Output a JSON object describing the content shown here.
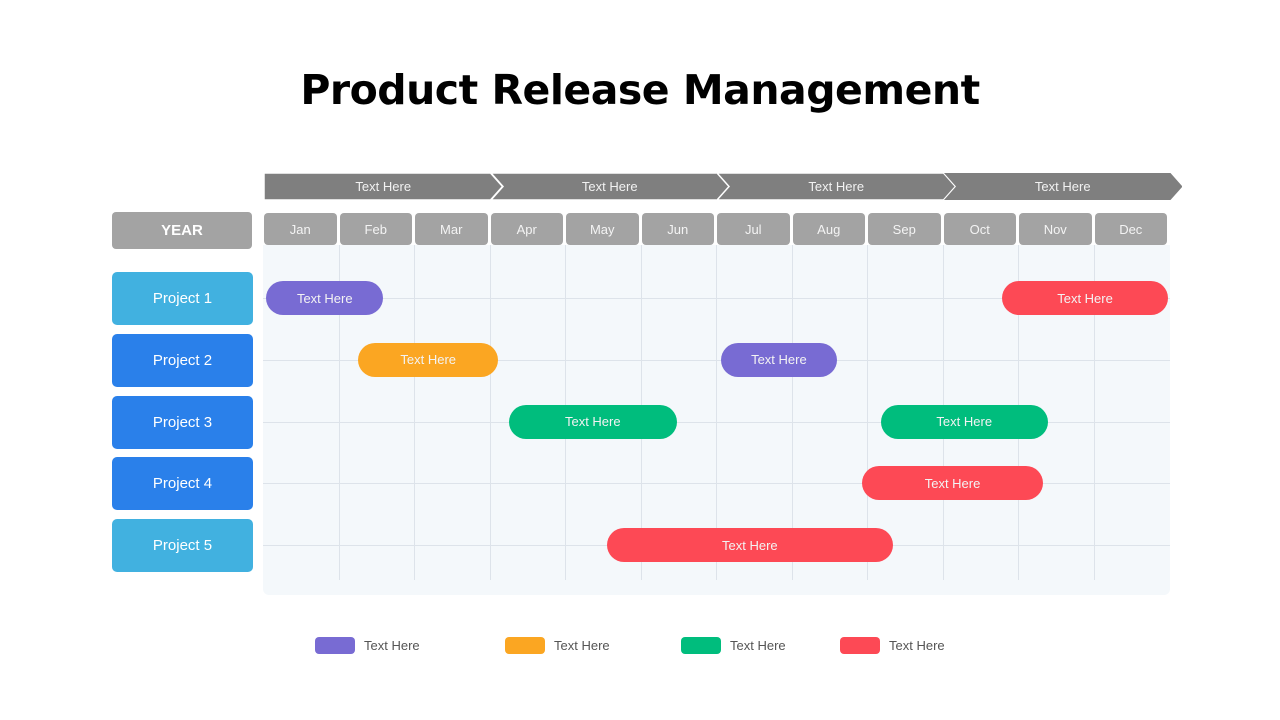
{
  "title": "Product Release Management",
  "chart_data": {
    "type": "gantt",
    "title": "Product Release Management",
    "year_label": "YEAR",
    "phases": [
      "Text Here",
      "Text Here",
      "Text Here",
      "Text Here"
    ],
    "phase_spans_months": [
      [
        0,
        3
      ],
      [
        3,
        6
      ],
      [
        6,
        9
      ],
      [
        9,
        12
      ]
    ],
    "months": [
      "Jan",
      "Feb",
      "Mar",
      "Apr",
      "May",
      "Jun",
      "Jul",
      "Aug",
      "Sep",
      "Oct",
      "Nov",
      "Dec"
    ],
    "projects": [
      {
        "label": "Project 1",
        "color": "#41b1e0"
      },
      {
        "label": "Project 2",
        "color": "#2a80ea"
      },
      {
        "label": "Project 3",
        "color": "#2a80ea"
      },
      {
        "label": "Project 4",
        "color": "#2a80ea"
      },
      {
        "label": "Project 5",
        "color": "#41b1e0"
      }
    ],
    "tasks": [
      {
        "project": 0,
        "label": "Text Here",
        "category": 0,
        "start": 0.03,
        "end": 1.58
      },
      {
        "project": 0,
        "label": "Text Here",
        "category": 3,
        "start": 9.78,
        "end": 11.97
      },
      {
        "project": 1,
        "label": "Text Here",
        "category": 1,
        "start": 1.25,
        "end": 3.1
      },
      {
        "project": 1,
        "label": "Text Here",
        "category": 0,
        "start": 6.05,
        "end": 7.59
      },
      {
        "project": 2,
        "label": "Text Here",
        "category": 2,
        "start": 3.24,
        "end": 5.47
      },
      {
        "project": 2,
        "label": "Text Here",
        "category": 2,
        "start": 8.17,
        "end": 10.38
      },
      {
        "project": 3,
        "label": "Text Here",
        "category": 3,
        "start": 7.92,
        "end": 10.32
      },
      {
        "project": 4,
        "label": "Text Here",
        "category": 3,
        "start": 4.54,
        "end": 8.33
      }
    ],
    "legend": [
      {
        "label": "Text Here",
        "color": "#786bd3"
      },
      {
        "label": "Text Here",
        "color": "#fba622"
      },
      {
        "label": "Text Here",
        "color": "#00bd7d"
      },
      {
        "label": "Text Here",
        "color": "#fd4955"
      }
    ],
    "xlim_months": [
      0,
      12
    ],
    "grid": true,
    "legend_position": "bottom"
  }
}
